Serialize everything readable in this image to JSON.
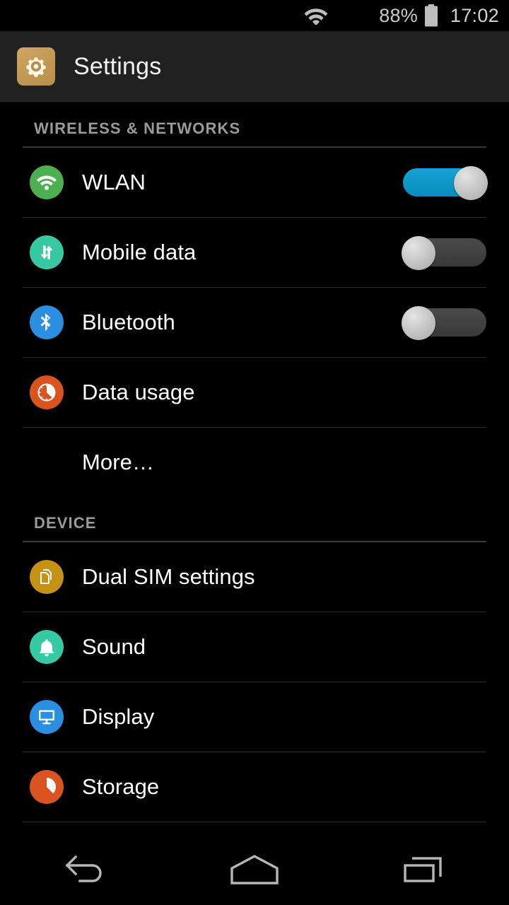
{
  "status_bar": {
    "wifi_icon": "wifi-icon",
    "battery_percent": "88%",
    "battery_icon": "battery-full-icon",
    "clock": "17:02"
  },
  "action_bar": {
    "icon": "settings-gear-icon",
    "title": "Settings"
  },
  "colors": {
    "background": "#000000",
    "action_bar": "#212121",
    "section_label": "#9a9a9a",
    "divider": "#2e2e2e",
    "switch_on_track": "#0d9dd4",
    "switch_off_track": "#414141",
    "switch_knob": "#c8c8c8",
    "icon_wlan": "#4caf50",
    "icon_mobile_data": "#37c9a4",
    "icon_bluetooth": "#2a8fe0",
    "icon_data_usage": "#d9541e",
    "icon_dual_sim": "#c69214",
    "icon_sound": "#37c9a4",
    "icon_display": "#2a8fe0",
    "icon_storage": "#d9541e",
    "app_icon": "#c39a55"
  },
  "sections": [
    {
      "header": "WIRELESS & NETWORKS",
      "rows": [
        {
          "label": "WLAN",
          "icon": "wifi-icon",
          "icon_color": "#4caf50",
          "control": "switch",
          "switch_state": "on"
        },
        {
          "label": "Mobile data",
          "icon": "data-transfer-icon",
          "icon_color": "#37c9a4",
          "control": "switch",
          "switch_state": "off"
        },
        {
          "label": "Bluetooth",
          "icon": "bluetooth-icon",
          "icon_color": "#2a8fe0",
          "control": "switch",
          "switch_state": "off"
        },
        {
          "label": "Data usage",
          "icon": "pie-chart-icon",
          "icon_color": "#d9541e",
          "control": "none"
        },
        {
          "label": "More…",
          "icon": null,
          "icon_color": null,
          "control": "none"
        }
      ]
    },
    {
      "header": "DEVICE",
      "rows": [
        {
          "label": "Dual SIM settings",
          "icon": "sim-cards-icon",
          "icon_color": "#c69214",
          "control": "none"
        },
        {
          "label": "Sound",
          "icon": "bell-icon",
          "icon_color": "#37c9a4",
          "control": "none"
        },
        {
          "label": "Display",
          "icon": "monitor-icon",
          "icon_color": "#2a8fe0",
          "control": "none"
        },
        {
          "label": "Storage",
          "icon": "pie-slice-icon",
          "icon_color": "#d9541e",
          "control": "none"
        }
      ]
    }
  ],
  "nav_bar": {
    "back": "back-icon",
    "home": "home-icon",
    "recents": "recents-icon"
  }
}
